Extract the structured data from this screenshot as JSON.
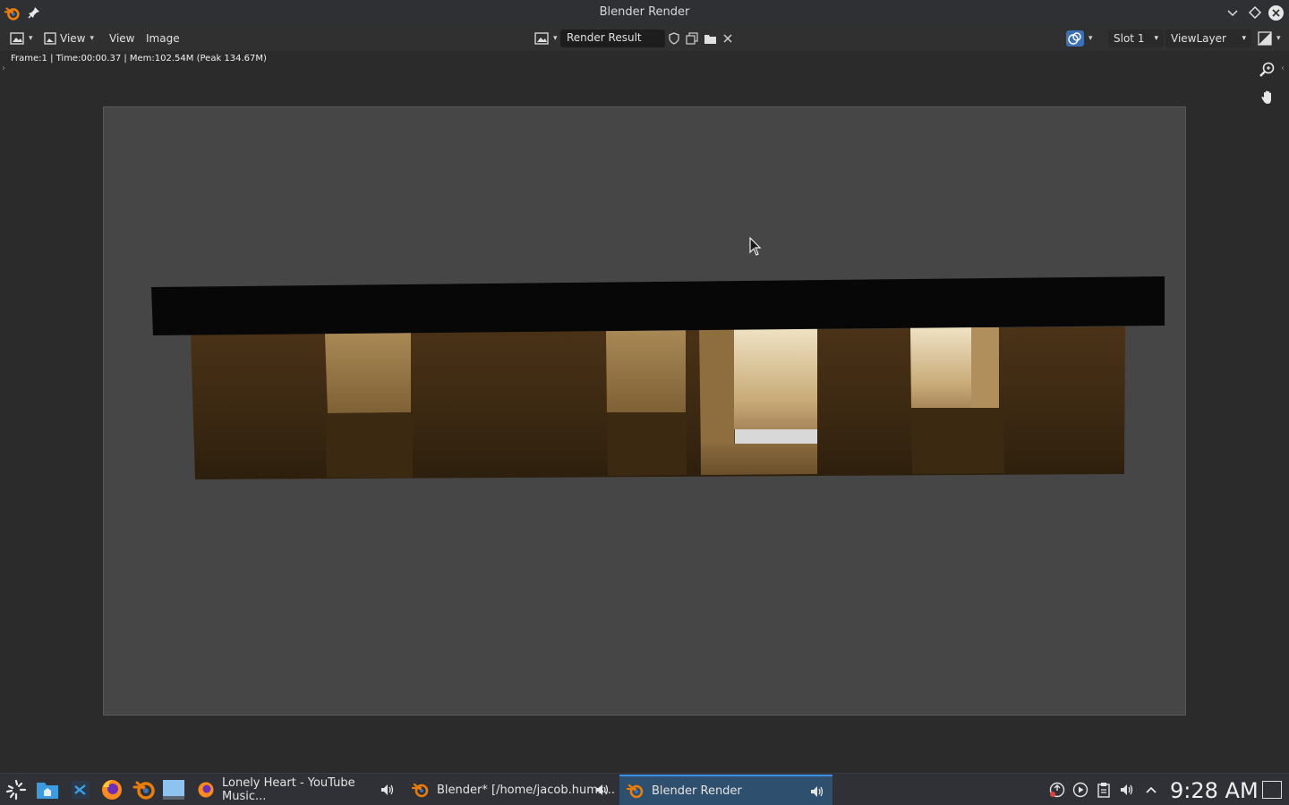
{
  "window": {
    "title": "Blender Render"
  },
  "header": {
    "view_menu_1": "View",
    "view_menu_2": "View",
    "image_menu": "Image",
    "image_name": "Render Result",
    "slot": "Slot 1",
    "view_layer": "ViewLayer"
  },
  "status": {
    "text": "Frame:1 | Time:00:00.37 | Mem:102.54M (Peak 134.67M)"
  },
  "taskbar": {
    "tasks": [
      {
        "label": "Lonely Heart - YouTube Music..."
      },
      {
        "label": "Blender* [/home/jacob.hums..."
      },
      {
        "label": "Blender Render"
      }
    ],
    "clock": "9:28 AM"
  },
  "colors": {
    "accent": "#3d8ee6",
    "blender_orange": "#e87d0d",
    "render_bg": "#464646"
  }
}
